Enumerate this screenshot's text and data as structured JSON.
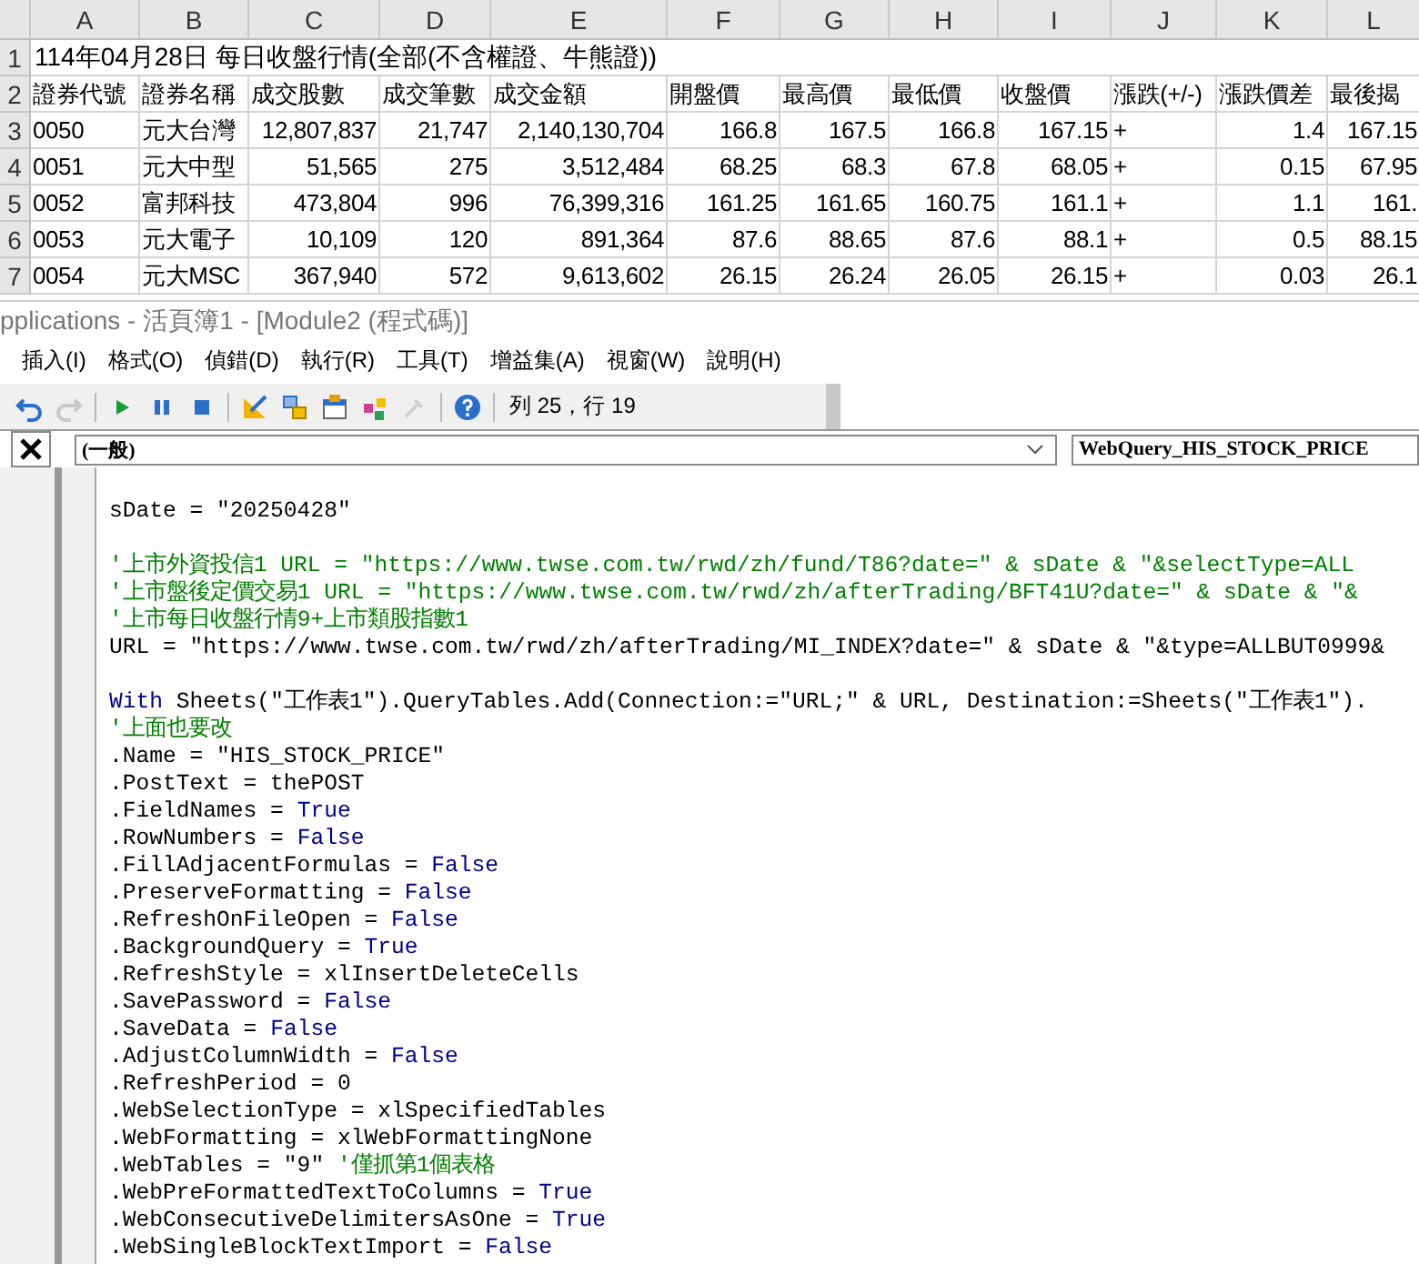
{
  "spreadsheet": {
    "columns": [
      "A",
      "B",
      "C",
      "D",
      "E",
      "F",
      "G",
      "H",
      "I",
      "J",
      "K",
      "L"
    ],
    "rows": [
      {
        "number": "1",
        "title": "114年04月28日 每日收盤行情(全部(不含權證、牛熊證))"
      },
      {
        "number": "2",
        "cells": [
          "證券代號",
          "證券名稱",
          "成交股數",
          "成交筆數",
          "成交金額",
          "開盤價",
          "最高價",
          "最低價",
          "收盤價",
          "漲跌(+/-)",
          "漲跌價差",
          "最後揭"
        ]
      },
      {
        "number": "3",
        "cells": [
          "0050",
          "元大台灣",
          "12,807,837",
          "21,747",
          "2,140,130,704",
          "166.8",
          "167.5",
          "166.8",
          "167.15",
          "+",
          "1.4",
          "167.15"
        ]
      },
      {
        "number": "4",
        "cells": [
          "0051",
          "元大中型",
          "51,565",
          "275",
          "3,512,484",
          "68.25",
          "68.3",
          "67.8",
          "68.05",
          "+",
          "0.15",
          "67.95"
        ]
      },
      {
        "number": "5",
        "cells": [
          "0052",
          "富邦科技",
          "473,804",
          "996",
          "76,399,316",
          "161.25",
          "161.65",
          "160.75",
          "161.1",
          "+",
          "1.1",
          "161."
        ]
      },
      {
        "number": "6",
        "cells": [
          "0053",
          "元大電子",
          "10,109",
          "120",
          "891,364",
          "87.6",
          "88.65",
          "87.6",
          "88.1",
          "+",
          "0.5",
          "88.15"
        ]
      },
      {
        "number": "7",
        "cells": [
          "0054",
          "元大MSC",
          "367,940",
          "572",
          "9,613,602",
          "26.15",
          "26.24",
          "26.05",
          "26.15",
          "+",
          "0.03",
          "26.1"
        ]
      }
    ]
  },
  "vbe": {
    "title": "pplications - 活頁簿1 - [Module2 (程式碼)]",
    "menu": [
      "插入(I)",
      "格式(O)",
      "偵錯(D)",
      "執行(R)",
      "工具(T)",
      "增益集(A)",
      "視窗(W)",
      "說明(H)"
    ],
    "toolbar": {
      "buttons": [
        {
          "kind": "undo",
          "disabled": false
        },
        {
          "kind": "redo",
          "disabled": true
        },
        {
          "kind": "run",
          "disabled": false
        },
        {
          "kind": "pause",
          "disabled": false
        },
        {
          "kind": "stop",
          "disabled": false
        },
        {
          "kind": "design",
          "disabled": false
        },
        {
          "kind": "explorer",
          "disabled": false
        },
        {
          "kind": "properties",
          "disabled": false
        },
        {
          "kind": "browser",
          "disabled": false
        },
        {
          "kind": "toolbox",
          "disabled": true
        },
        {
          "kind": "help",
          "disabled": false
        }
      ],
      "position": "列 25，行 19"
    },
    "object_combo": "(一般)",
    "procedure_combo": "WebQuery_HIS_STOCK_PRICE",
    "code_lines": [
      {
        "kind": "blank"
      },
      {
        "kind": "code",
        "segments": [
          {
            "kind": "plain",
            "text": "sDate = \"20250428\""
          }
        ]
      },
      {
        "kind": "blank"
      },
      {
        "kind": "code",
        "segments": [
          {
            "kind": "comment",
            "text": "'上市外資投信1 URL = \"https://www.twse.com.tw/rwd/zh/fund/T86?date=\" & sDate & \"&selectType=ALL"
          }
        ]
      },
      {
        "kind": "code",
        "segments": [
          {
            "kind": "comment",
            "text": "'上市盤後定價交易1 URL = \"https://www.twse.com.tw/rwd/zh/afterTrading/BFT41U?date=\" & sDate & \"&"
          }
        ]
      },
      {
        "kind": "code",
        "segments": [
          {
            "kind": "comment",
            "text": "'上市每日收盤行情9+上市類股指數1"
          }
        ]
      },
      {
        "kind": "code",
        "segments": [
          {
            "kind": "plain",
            "text": "URL = \"https://www.twse.com.tw/rwd/zh/afterTrading/MI_INDEX?date=\" & sDate & \"&type=ALLBUT0999&"
          }
        ]
      },
      {
        "kind": "blank"
      },
      {
        "kind": "code",
        "segments": [
          {
            "kind": "keyword",
            "text": "With"
          },
          {
            "kind": "plain",
            "text": " Sheets(\"工作表1\").QueryTables.Add(Connection:=\"URL;\" & URL, Destination:=Sheets(\"工作表1\")."
          }
        ]
      },
      {
        "kind": "code",
        "segments": [
          {
            "kind": "comment",
            "text": "'上面也要改"
          }
        ]
      },
      {
        "kind": "code",
        "segments": [
          {
            "kind": "plain",
            "text": ".Name = \"HIS_STOCK_PRICE\""
          }
        ]
      },
      {
        "kind": "code",
        "segments": [
          {
            "kind": "plain",
            "text": ".PostText = thePOST"
          }
        ]
      },
      {
        "kind": "code",
        "segments": [
          {
            "kind": "plain",
            "text": ".FieldNames = "
          },
          {
            "kind": "keyword",
            "text": "True"
          }
        ]
      },
      {
        "kind": "code",
        "segments": [
          {
            "kind": "plain",
            "text": ".RowNumbers = "
          },
          {
            "kind": "keyword",
            "text": "False"
          }
        ]
      },
      {
        "kind": "code",
        "segments": [
          {
            "kind": "plain",
            "text": ".FillAdjacentFormulas = "
          },
          {
            "kind": "keyword",
            "text": "False"
          }
        ]
      },
      {
        "kind": "code",
        "segments": [
          {
            "kind": "plain",
            "text": ".PreserveFormatting = "
          },
          {
            "kind": "keyword",
            "text": "False"
          }
        ]
      },
      {
        "kind": "code",
        "segments": [
          {
            "kind": "plain",
            "text": ".RefreshOnFileOpen = "
          },
          {
            "kind": "keyword",
            "text": "False"
          }
        ]
      },
      {
        "kind": "code",
        "segments": [
          {
            "kind": "plain",
            "text": ".BackgroundQuery = "
          },
          {
            "kind": "keyword",
            "text": "True"
          }
        ]
      },
      {
        "kind": "code",
        "segments": [
          {
            "kind": "plain",
            "text": ".RefreshStyle = xlInsertDeleteCells"
          }
        ]
      },
      {
        "kind": "code",
        "segments": [
          {
            "kind": "plain",
            "text": ".SavePassword = "
          },
          {
            "kind": "keyword",
            "text": "False"
          }
        ]
      },
      {
        "kind": "code",
        "segments": [
          {
            "kind": "plain",
            "text": ".SaveData = "
          },
          {
            "kind": "keyword",
            "text": "False"
          }
        ]
      },
      {
        "kind": "code",
        "segments": [
          {
            "kind": "plain",
            "text": ".AdjustColumnWidth = "
          },
          {
            "kind": "keyword",
            "text": "False"
          }
        ]
      },
      {
        "kind": "code",
        "segments": [
          {
            "kind": "plain",
            "text": ".RefreshPeriod = 0"
          }
        ]
      },
      {
        "kind": "code",
        "segments": [
          {
            "kind": "plain",
            "text": ".WebSelectionType = xlSpecifiedTables"
          }
        ]
      },
      {
        "kind": "code",
        "segments": [
          {
            "kind": "plain",
            "text": ".WebFormatting = xlWebFormattingNone"
          }
        ]
      },
      {
        "kind": "code",
        "segments": [
          {
            "kind": "plain",
            "text": ".WebTables = \"9\" "
          },
          {
            "kind": "comment",
            "text": "'僅抓第1個表格"
          }
        ]
      },
      {
        "kind": "code",
        "segments": [
          {
            "kind": "plain",
            "text": ".WebPreFormattedTextToColumns = "
          },
          {
            "kind": "keyword",
            "text": "True"
          }
        ]
      },
      {
        "kind": "code",
        "segments": [
          {
            "kind": "plain",
            "text": ".WebConsecutiveDelimitersAsOne = "
          },
          {
            "kind": "keyword",
            "text": "True"
          }
        ]
      },
      {
        "kind": "code",
        "segments": [
          {
            "kind": "plain",
            "text": ".WebSingleBlockTextImport = "
          },
          {
            "kind": "keyword",
            "text": "False"
          }
        ]
      }
    ]
  }
}
